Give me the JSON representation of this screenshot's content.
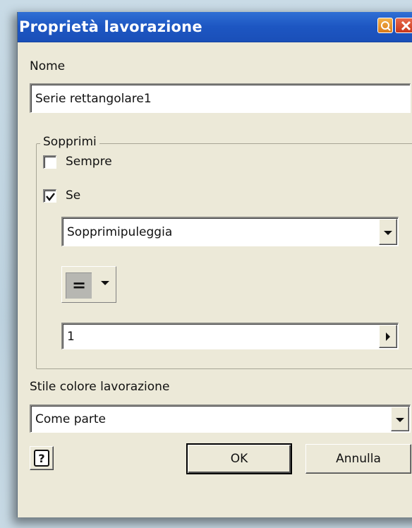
{
  "window": {
    "title": "Proprietà lavorazione"
  },
  "name_section": {
    "label": "Nome",
    "value": "Serie rettangolare1"
  },
  "suppress_group": {
    "legend": "Sopprimi",
    "always": {
      "label": "Sempre",
      "checked": false
    },
    "if": {
      "label": "Se",
      "checked": true
    },
    "parameter_select": {
      "value": "Sopprimipuleggia"
    },
    "operator": {
      "value": "="
    },
    "value_input": {
      "value": "1"
    }
  },
  "color_style": {
    "label": "Stile colore lavorazione",
    "value": "Come parte"
  },
  "buttons": {
    "ok": "OK",
    "cancel": "Annulla"
  },
  "icons": {
    "titlebar_help": "help-icon",
    "titlebar_close": "close-icon",
    "dropdown": "chevron-down-icon",
    "arrow_right": "chevron-right-icon",
    "help_button": "question-mark-icon"
  },
  "colors": {
    "titlebar": "#1d56c2",
    "dialog_bg": "#ece9d8"
  }
}
